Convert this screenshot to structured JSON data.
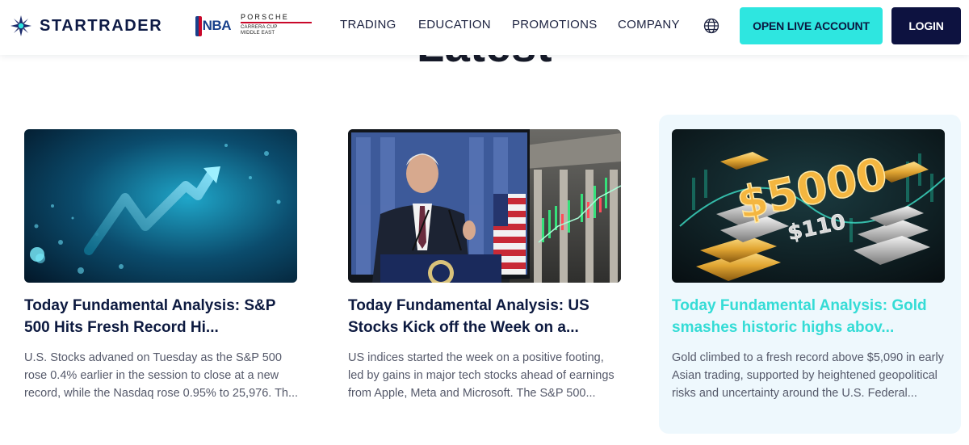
{
  "brand": {
    "name": "STARTRADER"
  },
  "partners": {
    "nba": "NBA",
    "porsche": {
      "name": "PORSCHE",
      "line1": "CARRERA CUP",
      "line2": "MIDDLE EAST"
    }
  },
  "nav": [
    {
      "label": "TRADING"
    },
    {
      "label": "EDUCATION"
    },
    {
      "label": "PROMOTIONS"
    },
    {
      "label": "COMPANY"
    }
  ],
  "actions": {
    "open_account": "OPEN LIVE ACCOUNT",
    "login": "LOGIN"
  },
  "section": {
    "title": "Latest"
  },
  "articles": [
    {
      "title": "Today Fundamental Analysis: S&P 500 Hits Fresh Record Hi...",
      "summary": "U.S. Stocks advaned on Tuesday as the S&P 500 rose 0.4% earlier in the session to close at a new record, while the Nasdaq rose 0.95% to 25,976. Th..."
    },
    {
      "title": "Today Fundamental Analysis: US Stocks Kick off the Week on a...",
      "summary": "US indices started the week on a positive footing, led by gains in major tech stocks ahead of earnings from Apple, Meta and Microsoft. The S&P 500..."
    },
    {
      "title": "Today Fundamental Analysis: Gold smashes historic highs abov...",
      "summary": "Gold climbed to a fresh record above $5,090 in early Asian trading, supported by heightened geopolitical risks and uncertainty around the U.S. Federal...",
      "image_text": {
        "big": "$5000",
        "small": "$110"
      }
    }
  ],
  "colors": {
    "accent": "#2ee6e0",
    "navy": "#0d1240",
    "active_title": "#35dcd6",
    "active_card_bg": "#eef8fd"
  }
}
